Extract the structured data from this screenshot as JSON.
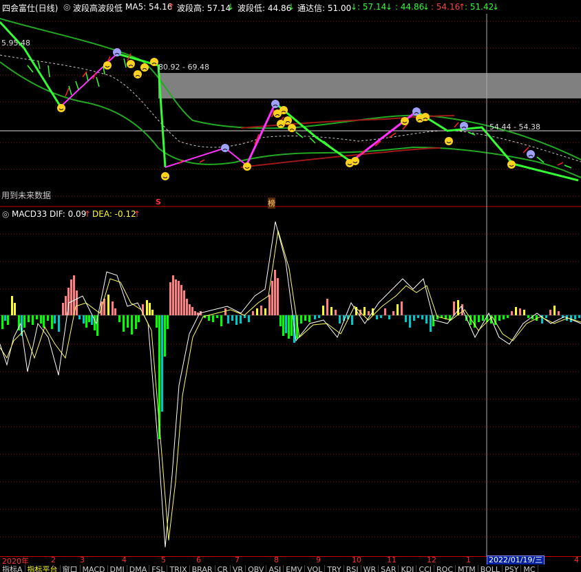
{
  "header": {
    "stock": "四会富仕(日线)",
    "indicator": "波段高波段低",
    "ma5": "MA5: 54.16",
    "wave_high": "波段高: 57.14",
    "wave_low": "波段低: 44.86",
    "tdx_label": "通达信: 51.00",
    "v1": ": 57.14",
    "v2": ": 44.86",
    "v3": ": 54.16",
    "v4": ": 51.42",
    "up": "↑",
    "down": "↓"
  },
  "main_chart": {
    "price_label_left": "5.95.48",
    "zone_label": "80.92 - 69.48",
    "right_label": "54.44 - 54.38",
    "future_data_note": "用到未来数据",
    "marker_s": "S",
    "marker_bang": "榜"
  },
  "sub_header": {
    "indicator": "MACD33",
    "dif": "DIF: 0.09",
    "dea": "DEA: -0.12"
  },
  "time_axis": {
    "labels": [
      "2020年",
      "2",
      "3",
      "4",
      "5",
      "6",
      "7",
      "8",
      "9",
      "10",
      "11",
      "12",
      "1",
      "4"
    ],
    "cursor_date": "2022/01/19/三"
  },
  "bottom_tabs": [
    "指标A",
    "指标平台",
    "窗口",
    "MACD",
    "DMI",
    "DMA",
    "FSL",
    "TRIX",
    "BRAR",
    "CR",
    "VR",
    "OBV",
    "ASI",
    "EMV",
    "VOL",
    "TRY",
    "RSI",
    "WR",
    "SAR",
    "KDJ",
    "CCI",
    "ROC",
    "MTM",
    "BOLL",
    "PSY",
    "MC"
  ],
  "colors": {
    "bg": "#000000",
    "up": "#ff3333",
    "down": "#33ff33",
    "macd_pos": "#ff8080",
    "macd_yellow": "#ffff33",
    "macd_neg": "#00ff00",
    "macd_cyan": "#00c8c8",
    "band": "#22aa22",
    "dif_line": "#ffffff",
    "dea_line": "#ffff66"
  }
}
